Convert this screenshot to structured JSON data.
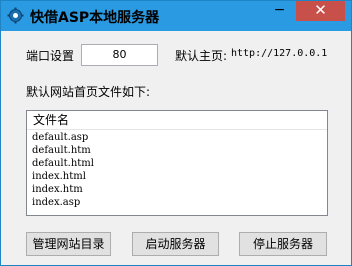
{
  "window": {
    "title": "快借ASP本地服务器",
    "minimize_glyph": "−",
    "close_glyph": "✕"
  },
  "settings": {
    "port_label": "端口设置",
    "port_value": "80",
    "homepage_label": "默认主页:",
    "homepage_value": "http://127.0.0.1"
  },
  "files": {
    "section_label": "默认网站首页文件如下:",
    "column_header": "文件名",
    "items": [
      "default.asp",
      "default.htm",
      "default.html",
      "index.html",
      "index.htm",
      "index.asp"
    ]
  },
  "buttons": {
    "manage_label": "管理网站目录",
    "start_label": "启动服务器",
    "stop_label": "停止服务器"
  },
  "icons": {
    "app": "gear-icon",
    "minimize": "minimize-icon",
    "close": "close-icon"
  },
  "colors": {
    "titlebar": "#2a9be3",
    "close_button": "#c7504b"
  }
}
